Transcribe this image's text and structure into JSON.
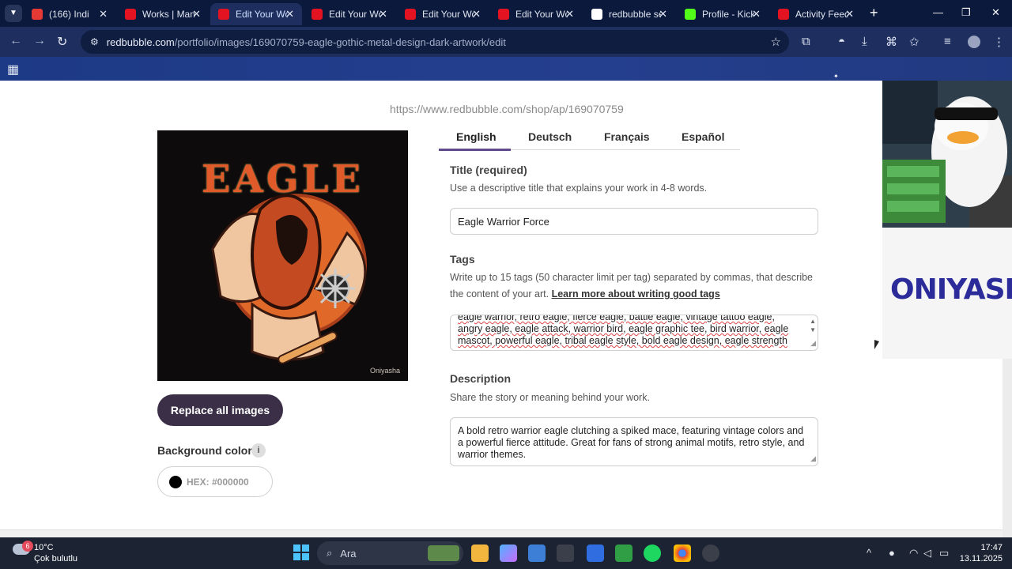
{
  "browser": {
    "tabs": [
      {
        "label": "(166) Indi",
        "favicon_color": "#e53935"
      },
      {
        "label": "Works | Mana",
        "favicon_color": "#e41321"
      },
      {
        "label": "Edit Your Wo",
        "favicon_color": "#e41321",
        "active": true
      },
      {
        "label": "Edit Your Wo",
        "favicon_color": "#e41321"
      },
      {
        "label": "Edit Your Wo",
        "favicon_color": "#e41321"
      },
      {
        "label": "Edit Your Wo",
        "favicon_color": "#e41321"
      },
      {
        "label": "redbubble se",
        "favicon_color": "#ffffff"
      },
      {
        "label": "Profile - Kick",
        "favicon_color": "#53fc18"
      },
      {
        "label": "Activity Feed",
        "favicon_color": "#e41321"
      }
    ],
    "url_host": "redbubble.com",
    "url_path": "/portfolio/images/169070759-eagle-gothic-metal-design-dark-artwork/edit"
  },
  "page": {
    "shop_url": "https://www.redbubble.com/shop/ap/169070759",
    "artwork": {
      "title_text": "EAGLE",
      "watermark": "Oniyasha"
    },
    "replace_button": "Replace all images",
    "background_color": {
      "label": "Background color",
      "hex": "HEX: #000000",
      "swatch": "#000000"
    },
    "languages": [
      "English",
      "Deutsch",
      "Français",
      "Español"
    ],
    "title_field": {
      "label": "Title (required)",
      "help": "Use a descriptive title that explains your work in 4-8 words.",
      "value": "Eagle Warrior Force"
    },
    "tags_field": {
      "label": "Tags",
      "help": "Write up to 15 tags (50 character limit per tag) separated by commas, that describe the content of your art.",
      "help_link": "Learn more about writing good tags",
      "lines": [
        "eagle warrior, retro eagle, fierce eagle, battle eagle, vintage tattoo eagle,",
        "angry eagle, eagle attack, warrior bird, eagle graphic tee, bird warrior, eagle",
        "mascot, powerful eagle, tribal eagle style, bold eagle design, eagle strength"
      ]
    },
    "description_field": {
      "label": "Description",
      "help": "Share the story or meaning behind your work.",
      "value": "A bold retro warrior eagle clutching a spiked mace, featuring vintage colors and a powerful fierce attitude. Great for fans of strong animal motifs, retro style, and warrior themes."
    }
  },
  "ad": {
    "brand": "ONIYASHA"
  },
  "taskbar": {
    "weather_badge": "6",
    "temperature": "10°C",
    "condition": "Çok bulutlu",
    "search_placeholder": "Ara",
    "time": "17:47",
    "date": "13.11.2025"
  }
}
